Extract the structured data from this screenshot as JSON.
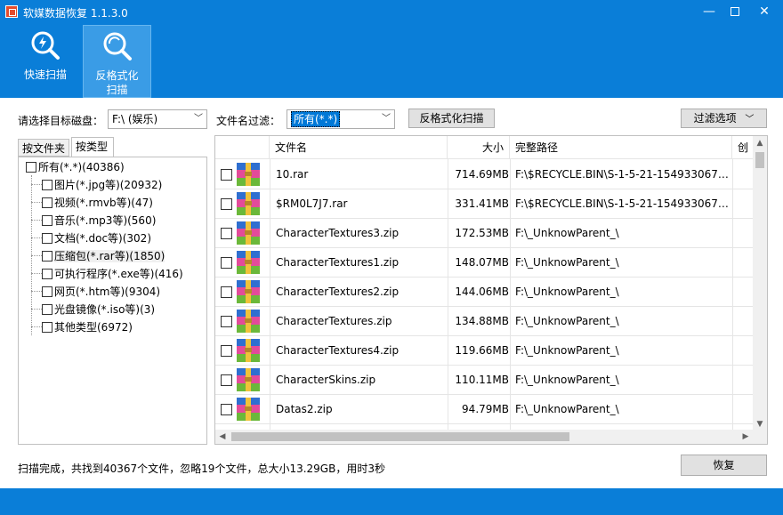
{
  "window": {
    "title": "软媒数据恢复 1.1.3.0"
  },
  "toolbar": {
    "quick_scan": "快速扫描",
    "unformat_scan": "反格式化\n扫描"
  },
  "filters": {
    "disk_label": "请选择目标磁盘：",
    "disk_value": "F:\\  (娱乐)",
    "filename_label": "文件名过滤：",
    "filename_value": "所有(*.*)",
    "unformat_button": "反格式化扫描",
    "filter_options_button": "过滤选项"
  },
  "tabs": [
    "按文件夹",
    "按类型"
  ],
  "tree": {
    "root": "所有(*.*)(40386)",
    "children": [
      "图片(*.jpg等)(20932)",
      "视频(*.rmvb等)(47)",
      "音乐(*.mp3等)(560)",
      "文档(*.doc等)(302)",
      "压缩包(*.rar等)(1850)",
      "可执行程序(*.exe等)(416)",
      "网页(*.htm等)(9304)",
      "光盘镜像(*.iso等)(3)",
      "其他类型(6972)"
    ]
  },
  "list": {
    "columns": {
      "name": "文件名",
      "size": "大小",
      "path": "完整路径",
      "extra": "创"
    },
    "rows": [
      {
        "name": "10.rar",
        "size": "714.69MB",
        "path": "F:\\$RECYCLE.BIN\\S-1-5-21-1549330675..."
      },
      {
        "name": "$RM0L7J7.rar",
        "size": "331.41MB",
        "path": "F:\\$RECYCLE.BIN\\S-1-5-21-1549330675..."
      },
      {
        "name": "CharacterTextures3.zip",
        "size": "172.53MB",
        "path": "F:\\_UnknowParent_\\"
      },
      {
        "name": "CharacterTextures1.zip",
        "size": "148.07MB",
        "path": "F:\\_UnknowParent_\\"
      },
      {
        "name": "CharacterTextures2.zip",
        "size": "144.06MB",
        "path": "F:\\_UnknowParent_\\"
      },
      {
        "name": "CharacterTextures.zip",
        "size": "134.88MB",
        "path": "F:\\_UnknowParent_\\"
      },
      {
        "name": "CharacterTextures4.zip",
        "size": "119.66MB",
        "path": "F:\\_UnknowParent_\\"
      },
      {
        "name": "CharacterSkins.zip",
        "size": "110.11MB",
        "path": "F:\\_UnknowParent_\\"
      },
      {
        "name": "Datas2.zip",
        "size": "94.79MB",
        "path": "F:\\_UnknowParent_\\"
      }
    ]
  },
  "status": {
    "text": "扫描完成，共找到40367个文件，忽略19个文件，总大小13.29GB，用时3秒",
    "recover_button": "恢复"
  },
  "colors": {
    "accent": "#0a7ed8"
  }
}
